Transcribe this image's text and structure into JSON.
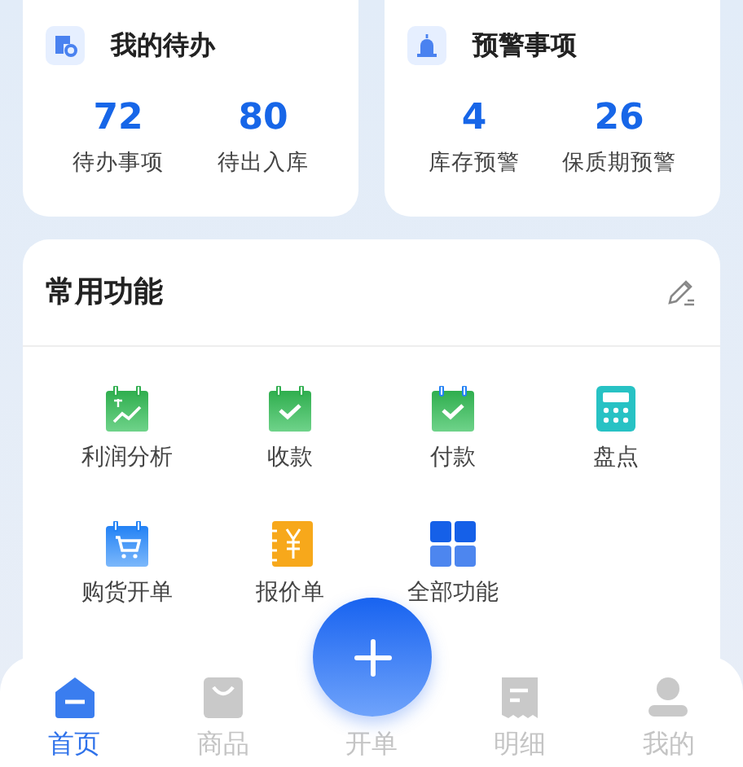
{
  "summary_cards": [
    {
      "title": "我的待办",
      "kind": "todo",
      "stats": [
        {
          "value": "72",
          "label": "待办事项"
        },
        {
          "value": "80",
          "label": "待出入库"
        }
      ]
    },
    {
      "title": "预警事项",
      "kind": "alert",
      "stats": [
        {
          "value": "4",
          "label": "库存预警"
        },
        {
          "value": "26",
          "label": "保质期预警"
        }
      ]
    }
  ],
  "functions": {
    "title": "常用功能",
    "items": [
      {
        "label": "利润分析",
        "kind": "profit"
      },
      {
        "label": "收款",
        "kind": "receive"
      },
      {
        "label": "付款",
        "kind": "pay"
      },
      {
        "label": "盘点",
        "kind": "calculator"
      },
      {
        "label": "购货开单",
        "kind": "purchase"
      },
      {
        "label": "报价单",
        "kind": "quote"
      },
      {
        "label": "全部功能",
        "kind": "all"
      }
    ]
  },
  "tabs": [
    {
      "label": "首页",
      "kind": "home",
      "selected": true
    },
    {
      "label": "商品",
      "kind": "goods",
      "selected": false
    },
    {
      "label": "开单",
      "kind": "order",
      "selected": false
    },
    {
      "label": "明细",
      "kind": "detail",
      "selected": false
    },
    {
      "label": "我的",
      "kind": "me",
      "selected": false
    }
  ]
}
